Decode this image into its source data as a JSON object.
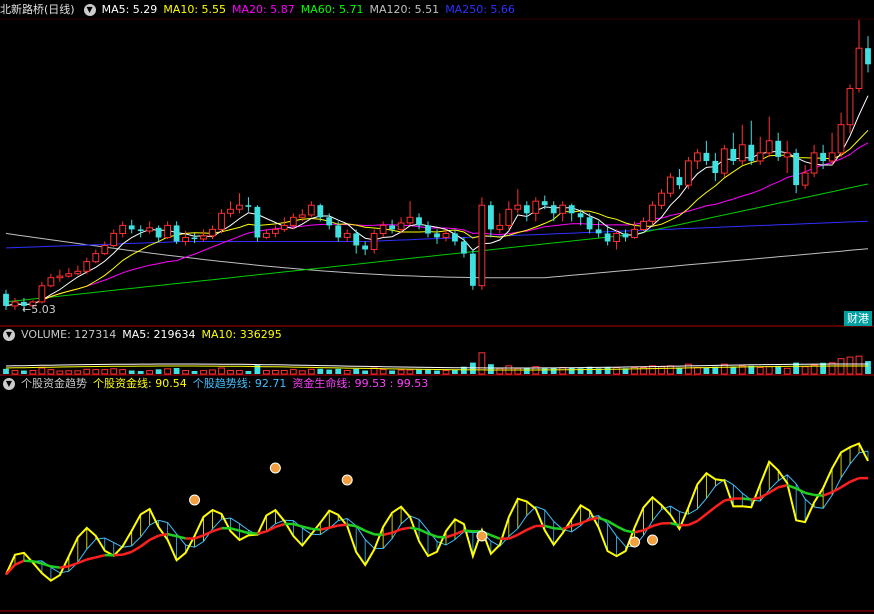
{
  "price_header": {
    "title": "北新路桥(日线)",
    "items": [
      {
        "label": "MA5: 5.29",
        "color": "#ffffff"
      },
      {
        "label": "MA10: 5.55",
        "color": "#ffff00"
      },
      {
        "label": "MA20: 5.87",
        "color": "#ff00ff"
      },
      {
        "label": "MA60: 5.71",
        "color": "#00ff00"
      },
      {
        "label": "MA120: 5.51",
        "color": "#c0c0c0"
      },
      {
        "label": "MA250: 5.66",
        "color": "#3030ff"
      }
    ]
  },
  "volume_header": {
    "title": "VOLUME: 127314",
    "items": [
      {
        "label": "MA5: 219634",
        "color": "#ffffff"
      },
      {
        "label": "MA10: 336295",
        "color": "#ffff00"
      }
    ]
  },
  "indicator_header": {
    "title": "个股资金趋势",
    "items": [
      {
        "label": "个股资金线: 90.54",
        "color": "#ffff00"
      },
      {
        "label": "个股趋势线: 92.71",
        "color": "#40c0ff"
      },
      {
        "label": "资金生命线: 99.53 : 99.53",
        "color": "#ff40ff"
      }
    ]
  },
  "low_label": "←5.03",
  "badge": "财港",
  "colors": {
    "up": "#ff3030",
    "down": "#40e0e0",
    "bg": "#000000",
    "divider": "#b00000"
  },
  "chart_data": {
    "type": "candlestick",
    "price_range": [
      4.9,
      8.6
    ],
    "candles": [
      [
        5.2,
        5.05,
        5.25,
        5.0
      ],
      [
        5.05,
        5.1,
        5.15,
        5.0
      ],
      [
        5.1,
        5.05,
        5.15,
        4.98
      ],
      [
        5.05,
        5.1,
        5.12,
        5.03
      ],
      [
        5.1,
        5.3,
        5.35,
        5.08
      ],
      [
        5.3,
        5.4,
        5.45,
        5.28
      ],
      [
        5.4,
        5.42,
        5.5,
        5.35
      ],
      [
        5.42,
        5.45,
        5.52,
        5.4
      ],
      [
        5.45,
        5.48,
        5.55,
        5.43
      ],
      [
        5.48,
        5.6,
        5.65,
        5.45
      ],
      [
        5.6,
        5.7,
        5.75,
        5.58
      ],
      [
        5.7,
        5.8,
        5.85,
        5.68
      ],
      [
        5.8,
        5.95,
        6.0,
        5.78
      ],
      [
        5.95,
        6.05,
        6.1,
        5.9
      ],
      [
        6.05,
        6.0,
        6.12,
        5.95
      ],
      [
        6.0,
        5.98,
        6.05,
        5.9
      ],
      [
        5.98,
        6.02,
        6.1,
        5.95
      ],
      [
        6.02,
        5.9,
        6.05,
        5.85
      ],
      [
        5.9,
        6.05,
        6.1,
        5.88
      ],
      [
        6.05,
        5.85,
        6.1,
        5.82
      ],
      [
        5.85,
        5.9,
        5.98,
        5.8
      ],
      [
        5.9,
        5.88,
        5.95,
        5.83
      ],
      [
        5.88,
        5.92,
        6.0,
        5.85
      ],
      [
        5.92,
        6.0,
        6.05,
        5.88
      ],
      [
        6.0,
        6.2,
        6.25,
        5.95
      ],
      [
        6.2,
        6.25,
        6.35,
        6.15
      ],
      [
        6.25,
        6.3,
        6.45,
        6.2
      ],
      [
        6.3,
        6.28,
        6.4,
        6.22
      ],
      [
        6.28,
        5.9,
        6.3,
        5.85
      ],
      [
        5.9,
        5.95,
        6.0,
        5.88
      ],
      [
        5.95,
        6.0,
        6.05,
        5.9
      ],
      [
        6.0,
        6.05,
        6.15,
        5.97
      ],
      [
        6.05,
        6.15,
        6.2,
        6.0
      ],
      [
        6.15,
        6.18,
        6.25,
        6.1
      ],
      [
        6.18,
        6.3,
        6.35,
        6.15
      ],
      [
        6.3,
        6.15,
        6.32,
        6.1
      ],
      [
        6.15,
        6.05,
        6.2,
        6.0
      ],
      [
        6.05,
        5.9,
        6.1,
        5.85
      ],
      [
        5.9,
        5.95,
        6.0,
        5.85
      ],
      [
        5.95,
        5.8,
        6.0,
        5.7
      ],
      [
        5.8,
        5.75,
        5.85,
        5.68
      ],
      [
        5.75,
        5.95,
        6.0,
        5.7
      ],
      [
        5.95,
        6.05,
        6.1,
        5.9
      ],
      [
        6.05,
        6.0,
        6.12,
        5.95
      ],
      [
        6.0,
        6.08,
        6.15,
        5.95
      ],
      [
        6.08,
        6.15,
        6.35,
        6.05
      ],
      [
        6.15,
        6.05,
        6.2,
        6.0
      ],
      [
        6.05,
        5.95,
        6.1,
        5.9
      ],
      [
        5.95,
        5.9,
        6.0,
        5.82
      ],
      [
        5.9,
        5.95,
        6.0,
        5.85
      ],
      [
        5.95,
        5.85,
        6.0,
        5.8
      ],
      [
        5.85,
        5.7,
        5.9,
        5.65
      ],
      [
        5.7,
        5.3,
        5.75,
        5.25
      ],
      [
        5.3,
        6.3,
        6.4,
        5.25
      ],
      [
        6.3,
        6.0,
        6.35,
        5.9
      ],
      [
        6.0,
        6.05,
        6.2,
        5.95
      ],
      [
        6.05,
        6.25,
        6.35,
        6.0
      ],
      [
        6.25,
        6.3,
        6.5,
        6.2
      ],
      [
        6.3,
        6.2,
        6.35,
        6.1
      ],
      [
        6.2,
        6.35,
        6.4,
        6.1
      ],
      [
        6.35,
        6.3,
        6.42,
        6.25
      ],
      [
        6.3,
        6.2,
        6.35,
        6.1
      ],
      [
        6.2,
        6.3,
        6.35,
        6.1
      ],
      [
        6.3,
        6.2,
        6.32,
        6.1
      ],
      [
        6.2,
        6.15,
        6.25,
        6.05
      ],
      [
        6.15,
        6.0,
        6.2,
        5.95
      ],
      [
        6.0,
        5.95,
        6.1,
        5.9
      ],
      [
        5.95,
        5.85,
        6.05,
        5.8
      ],
      [
        5.85,
        5.95,
        6.0,
        5.75
      ],
      [
        5.95,
        5.9,
        6.0,
        5.85
      ],
      [
        5.9,
        6.0,
        6.1,
        5.88
      ],
      [
        6.0,
        6.1,
        6.15,
        5.98
      ],
      [
        6.1,
        6.3,
        6.35,
        6.05
      ],
      [
        6.3,
        6.45,
        6.5,
        6.25
      ],
      [
        6.45,
        6.65,
        6.7,
        6.4
      ],
      [
        6.65,
        6.55,
        6.75,
        6.5
      ],
      [
        6.55,
        6.85,
        6.9,
        6.5
      ],
      [
        6.85,
        6.95,
        7.0,
        6.75
      ],
      [
        6.95,
        6.85,
        7.1,
        6.8
      ],
      [
        6.85,
        6.7,
        6.95,
        6.6
      ],
      [
        6.7,
        7.0,
        7.05,
        6.65
      ],
      [
        7.0,
        6.85,
        7.2,
        6.8
      ],
      [
        6.85,
        7.05,
        7.3,
        6.8
      ],
      [
        7.05,
        6.85,
        7.35,
        6.8
      ],
      [
        6.85,
        6.95,
        7.15,
        6.8
      ],
      [
        6.95,
        7.1,
        7.4,
        6.9
      ],
      [
        7.1,
        6.9,
        7.2,
        6.85
      ],
      [
        6.9,
        6.95,
        7.1,
        6.7
      ],
      [
        6.95,
        6.55,
        7.0,
        6.45
      ],
      [
        6.55,
        6.7,
        6.8,
        6.5
      ],
      [
        6.7,
        6.95,
        7.05,
        6.65
      ],
      [
        6.95,
        6.85,
        7.05,
        6.75
      ],
      [
        6.85,
        6.95,
        7.2,
        6.8
      ],
      [
        6.95,
        7.3,
        7.45,
        6.9
      ],
      [
        7.3,
        7.75,
        7.8,
        7.2
      ],
      [
        7.75,
        8.25,
        8.6,
        7.7
      ],
      [
        8.25,
        8.05,
        8.4,
        7.95
      ]
    ],
    "volume_range": [
      0,
      1600000
    ],
    "indicator_range": [
      0,
      110
    ]
  }
}
